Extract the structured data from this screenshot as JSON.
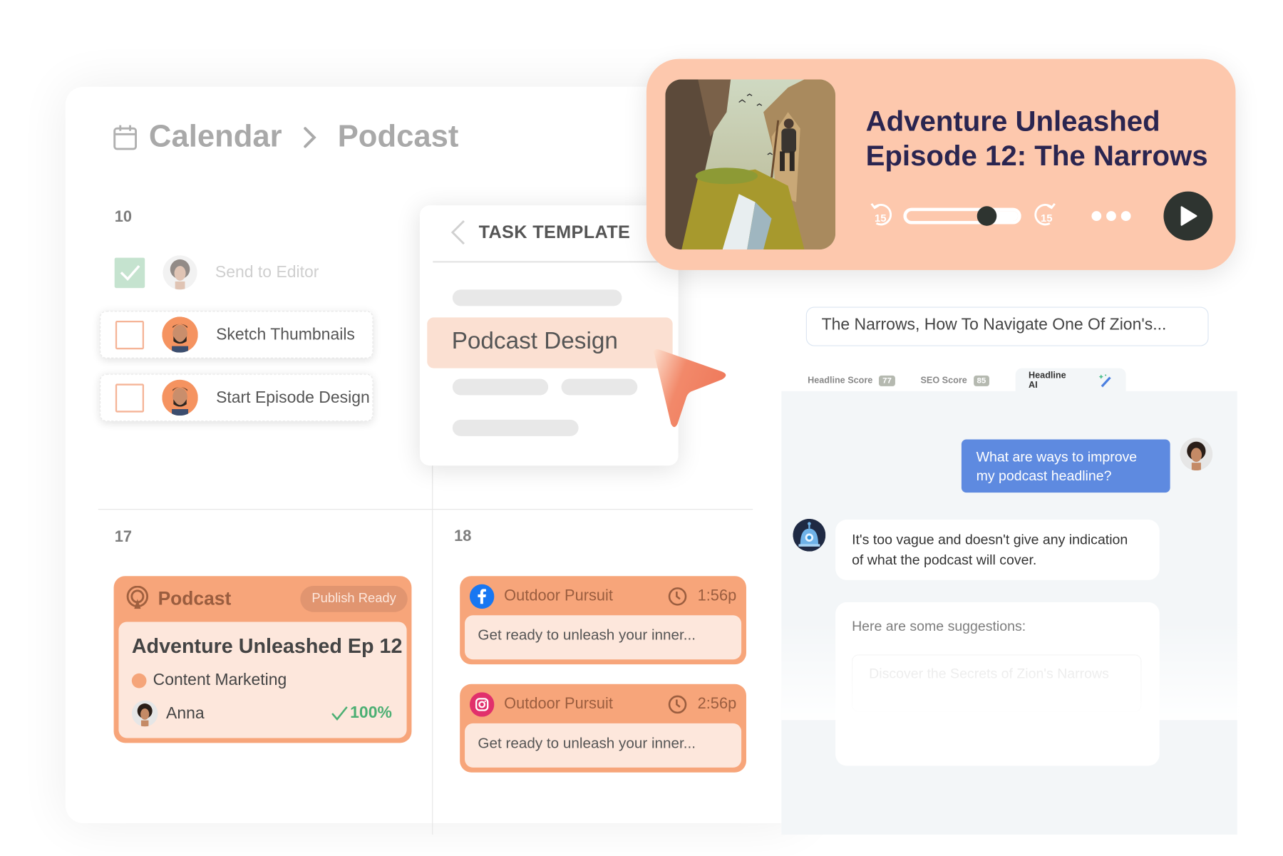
{
  "breadcrumb": {
    "icon": "calendar-icon",
    "items": [
      "Calendar",
      "Podcast"
    ],
    "separator": "›"
  },
  "week1": {
    "day": "10",
    "tasks": [
      {
        "label": "Send to Editor",
        "done": true,
        "assignee": "avatar-woman"
      },
      {
        "label": "Sketch Thumbnails",
        "done": false,
        "assignee": "avatar-man"
      },
      {
        "label": "Start Episode Design",
        "done": false,
        "assignee": "avatar-man"
      }
    ]
  },
  "task_template": {
    "title": "TASK TEMPLATE",
    "back_icon": "chevron-left-icon",
    "selected_item": "Podcast Design"
  },
  "player": {
    "title_line1": "Adventure Unleashed",
    "title_line2": "Episode 12: The Narrows",
    "rewind_label": "15",
    "forward_label": "15",
    "progress": 0.72,
    "more_icon": "more-dots-icon",
    "play_icon": "play-icon"
  },
  "headline": {
    "input_value": "The Narrows, How To Navigate One Of Zion's...",
    "tabs": [
      {
        "label": "Headline Score",
        "badge": "77"
      },
      {
        "label": "SEO Score",
        "badge": "85"
      },
      {
        "label": "Headline AI",
        "icon": "magic-wand-icon",
        "active": true
      }
    ]
  },
  "chat": {
    "user_message": "What are ways to improve my podcast headline?",
    "bot_message": "It's too vague and doesn't give any indication of what the podcast will cover.",
    "suggestions_label": "Here are some suggestions:",
    "suggestions": [
      "Discover the Secrets of Zion's Narrows"
    ]
  },
  "week2": {
    "day17": "17",
    "day18": "18",
    "podcast_card": {
      "category": "Podcast",
      "status": "Publish Ready",
      "title": "Adventure Unleashed Ep 12",
      "tag": "Content Marketing",
      "tag_color": "#f5a57a",
      "assignee": "Anna",
      "completion": "100%"
    },
    "social_posts": [
      {
        "network": "facebook",
        "account": "Outdoor Pursuit",
        "time": "1:56p",
        "text": "Get ready to unleash your inner..."
      },
      {
        "network": "instagram",
        "account": "Outdoor Pursuit",
        "time": "2:56p",
        "text": "Get ready to unleash your inner..."
      }
    ]
  },
  "colors": {
    "accent": "#f7a57a",
    "accent_light": "#fde7dc",
    "player_bg": "#fdc8ad",
    "title_navy": "#2a2550",
    "chat_user": "#5e8ae0",
    "success": "#4caf73",
    "facebook": "#1877f2",
    "instagram": "#e1306c"
  }
}
